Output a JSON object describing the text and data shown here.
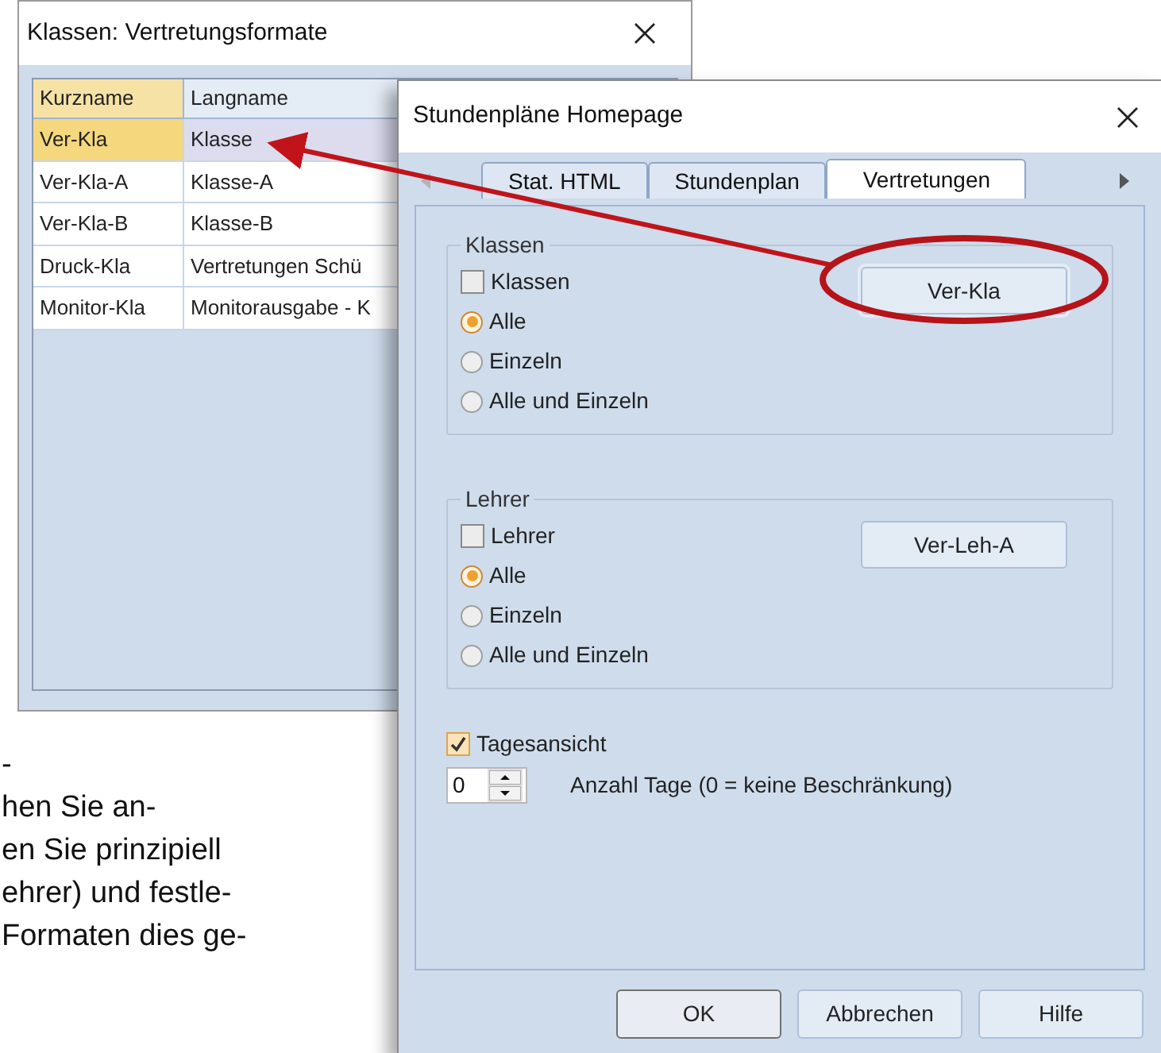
{
  "background_window": {
    "title": "Klassen: Vertretungsformate",
    "table": {
      "columns": [
        "Kurzname",
        "Langname"
      ],
      "rows": [
        {
          "cells": [
            "Ver-Kla",
            "Klasse"
          ],
          "selected": true
        },
        {
          "cells": [
            "Ver-Kla-A",
            "Klasse-A"
          ],
          "selected": false
        },
        {
          "cells": [
            "Ver-Kla-B",
            "Klasse-B"
          ],
          "selected": false
        },
        {
          "cells": [
            "Druck-Kla",
            "Vertretungen Schü"
          ],
          "selected": false
        },
        {
          "cells": [
            "Monitor-Kla",
            "Monitorausgabe - K"
          ],
          "selected": false
        }
      ]
    }
  },
  "background_text": [
    "-",
    "hen Sie an-",
    "en Sie prinzipiell",
    "ehrer) und festle-",
    "Formaten dies ge-"
  ],
  "dialog": {
    "title": "Stundenpläne Homepage",
    "tabs": [
      {
        "label": "Stat. HTML",
        "selected": false
      },
      {
        "label": "Stundenplan",
        "selected": false
      },
      {
        "label": "Vertretungen",
        "selected": true
      }
    ],
    "groups": [
      {
        "title": "Klassen",
        "checkbox": {
          "label": "Klassen",
          "checked": false
        },
        "button": "Ver-Kla",
        "highlighted": true,
        "options": [
          {
            "label": "Alle",
            "selected": true
          },
          {
            "label": "Einzeln",
            "selected": false
          },
          {
            "label": "Alle und Einzeln",
            "selected": false
          }
        ]
      },
      {
        "title": "Lehrer",
        "checkbox": {
          "label": "Lehrer",
          "checked": false
        },
        "button": "Ver-Leh-A",
        "highlighted": false,
        "options": [
          {
            "label": "Alle",
            "selected": true
          },
          {
            "label": "Einzeln",
            "selected": false
          },
          {
            "label": "Alle und Einzeln",
            "selected": false
          }
        ]
      }
    ],
    "day_view": {
      "label": "Tagesansicht",
      "checked": true
    },
    "days": {
      "value": "0",
      "label": "Anzahl Tage (0 = keine Beschränkung)"
    },
    "buttons": [
      "OK",
      "Abbrechen",
      "Hilfe"
    ]
  }
}
